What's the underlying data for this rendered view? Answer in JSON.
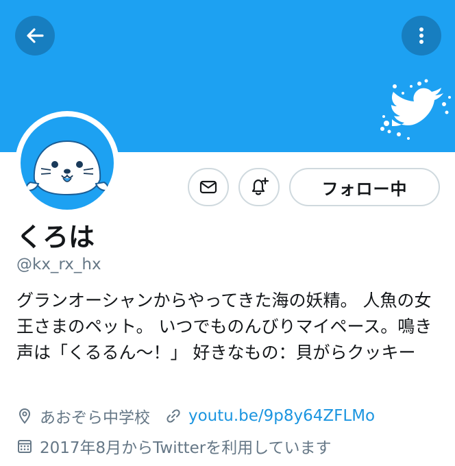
{
  "header": {
    "banner_color": "#1da1f2",
    "back_icon": "arrow-left-icon",
    "more_icon": "more-vertical-icon",
    "banner_decoration": "bird-icon"
  },
  "actions": {
    "mail_icon": "mail-icon",
    "notify_icon": "bell-plus-icon",
    "follow_label": "フォロー中"
  },
  "profile": {
    "name": "くろは",
    "handle": "@kx_rx_hx",
    "bio": "グランオーシャンからやってきた海の妖精。 人魚の女王さまのペット。 いつでものんびりマイペース。鳴き声は「くるるん〜！」 好きなもの：貝がらクッキー",
    "location": "あおぞら中学校",
    "website": "youtu.be/9p8y64ZFLMo",
    "joined": "2017年8月からTwitterを利用しています"
  },
  "colors": {
    "accent": "#1da1f2",
    "link": "#1b95e0",
    "secondary_text": "#657786"
  }
}
